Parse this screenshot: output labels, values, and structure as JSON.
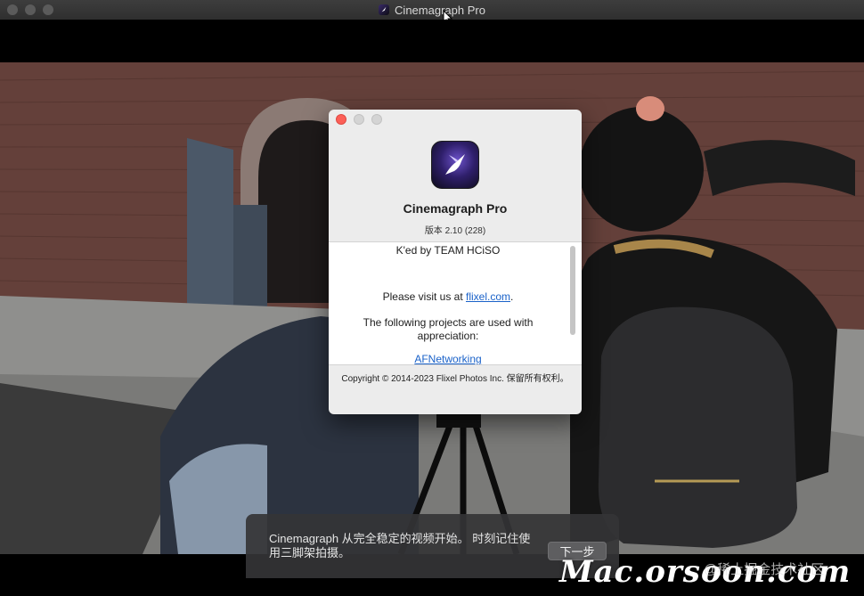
{
  "window": {
    "title": "Cinemagraph Pro"
  },
  "about_dialog": {
    "app_name": "Cinemagraph Pro",
    "version": "版本 2.10 (228)",
    "credits": {
      "line1": "K'ed by TEAM HCiSO",
      "visit_prefix": "Please visit us at ",
      "visit_link": "flixel.com",
      "visit_suffix": ".",
      "projects_text": "The following projects are used with appreciation:",
      "project_link": "AFNetworking"
    },
    "copyright": "Copyright © 2014-2023 Flixel Photos Inc. 保留所有权利。"
  },
  "hint_panel": {
    "text": "Cinemagraph 从完全稳定的视频开始。 时刻记住使用三脚架拍摄。",
    "next_button": "下一步"
  },
  "watermark": {
    "text": "Mac.orsoon.com",
    "community": "@稀土掘金技术社区"
  },
  "icons": [
    "app-icon",
    "hummingbird-icon",
    "mouse-cursor-icon"
  ],
  "colors": {
    "close_button": "#fc5f57",
    "link": "#1a62c9",
    "hint_panel": "#343436"
  }
}
